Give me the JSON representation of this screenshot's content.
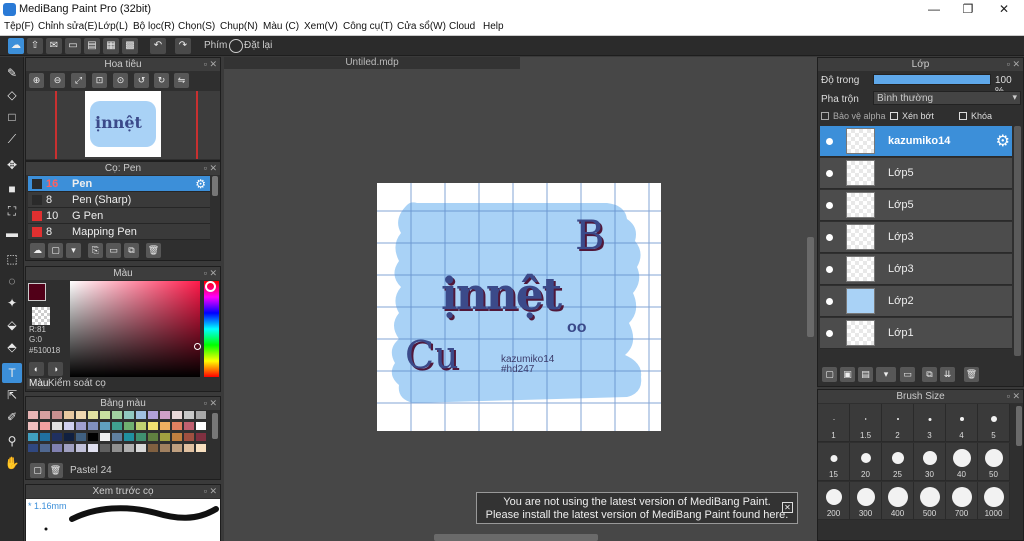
{
  "window": {
    "title": "MediBang Paint Pro (32bit)",
    "minimize": "—",
    "maximize": "❐",
    "close": "✕"
  },
  "menu": [
    "Tệp(F)",
    "Chỉnh sửa(E)",
    "Lớp(L)",
    "Bộ lọc(R)",
    "Chọn(S)",
    "Chụp(N)",
    "Màu (C)",
    "Xem(V)",
    "Công cụ(T)",
    "Cửa sổ(W)",
    "Cloud",
    "Help"
  ],
  "toolbar": {
    "key_label": "Phím",
    "reset_label": "Đặt lại"
  },
  "navigator": {
    "title": "Hoa tiêu"
  },
  "brush_panel": {
    "title": "Cọ: Pen",
    "items": [
      {
        "size": "16",
        "name": "Pen",
        "color": "#2a2a2a"
      },
      {
        "size": "8",
        "name": "Pen (Sharp)",
        "color": "#2a2a2a"
      },
      {
        "size": "10",
        "name": "G Pen",
        "color": "#e03030"
      },
      {
        "size": "8",
        "name": "Mapping Pen",
        "color": "#e03030"
      }
    ]
  },
  "color_panel": {
    "title": "Màu",
    "r": "R:81",
    "g": "G:0",
    "b": "B:24",
    "hex": "#510018",
    "tab_color": "Màu",
    "tab_control": "Kiểm soát cọ",
    "current_color": "#510018"
  },
  "palette": {
    "title": "Bảng màu",
    "name": "Pastel 24"
  },
  "preview": {
    "title": "Xem trước cọ",
    "size": "* 1.16mm"
  },
  "document": {
    "tab": "Untiled.mdp",
    "artwork": {
      "big_text": "ịnnệt",
      "letter_b": "B",
      "letter_c": "Cu",
      "oo": "oo",
      "sub_text": "oo",
      "watermark_name": "kazumiko14",
      "watermark_tag": "#hd247"
    }
  },
  "notice": {
    "line1": "You are not using the latest version of MediBang Paint.",
    "line2": "Please install the latest version of MediBang Paint found here.",
    "close": "✕"
  },
  "layer_panel": {
    "title": "Lớp",
    "opacity_label": "Độ trong",
    "opacity_value": "100 %",
    "opacity": 1.0,
    "blend_label": "Pha trộn",
    "blend_value": "Bình thường",
    "protect_alpha": "Bảo vệ alpha",
    "clipping": "Xén bớt",
    "lock": "Khóa",
    "layers": [
      {
        "name": "kazumiko14",
        "selected": true
      },
      {
        "name": "Lớp5",
        "selected": false
      },
      {
        "name": "Lớp5",
        "selected": false
      },
      {
        "name": "Lớp3",
        "selected": false
      },
      {
        "name": "Lớp3",
        "selected": false
      },
      {
        "name": "Lớp2",
        "selected": false
      },
      {
        "name": "Lớp1",
        "selected": false
      }
    ]
  },
  "brush_size": {
    "title": "Brush Size",
    "sizes": [
      "1",
      "1.5",
      "2",
      "3",
      "4",
      "5",
      "15",
      "20",
      "25",
      "30",
      "40",
      "50",
      "200",
      "300",
      "400",
      "500",
      "700",
      "1000"
    ]
  },
  "colors": {
    "accent": "#3c8fd9",
    "canvas_blue": "#a9d2f6",
    "ink": "#3b4a8a"
  }
}
